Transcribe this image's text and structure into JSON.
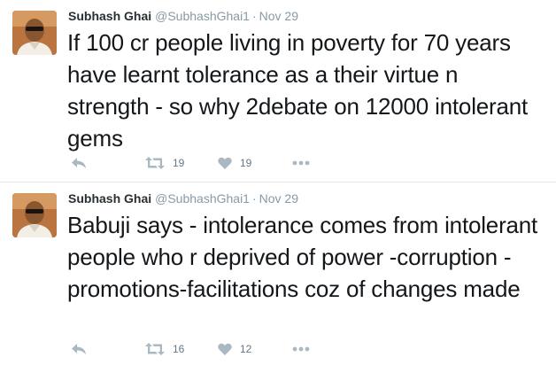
{
  "tweets": [
    {
      "author_name": "Subhash Ghai",
      "handle": "@SubhashGhai1",
      "separator": "·",
      "date": "Nov 29",
      "text": "If 100 cr people living in poverty for 70 years have learnt tolerance as a their virtue n strength - so why 2debate on 12000 intolerant gems",
      "retweets": "19",
      "likes": "19"
    },
    {
      "author_name": "Subhash Ghai",
      "handle": "@SubhashGhai1",
      "separator": "·",
      "date": "Nov 29",
      "text": "Babuji says - intolerance comes from intolerant people who r deprived of power -corruption -promotions-facilitations coz of changes made",
      "retweets": "16",
      "likes": "12"
    }
  ],
  "icons": {
    "reply": "reply-icon",
    "retweet": "retweet-icon",
    "like": "heart-icon",
    "more": "more-dots-icon"
  },
  "colors": {
    "icon_gray": "#aab8c2",
    "count_gray": "#657786",
    "meta_gray": "#8899a6",
    "divider": "#e1e8ed"
  }
}
